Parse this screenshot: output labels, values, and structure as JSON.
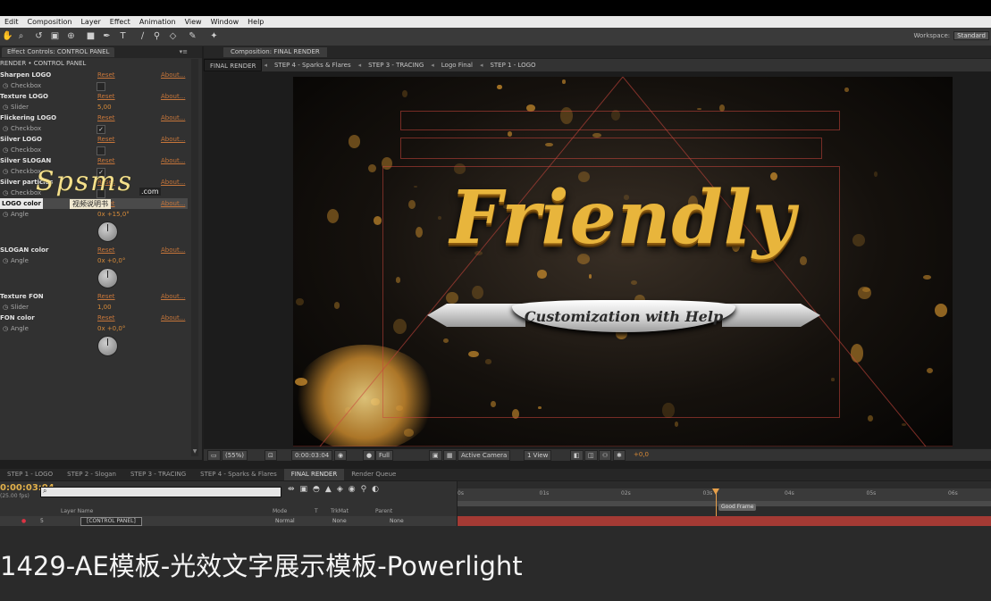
{
  "menu": [
    "Edit",
    "Composition",
    "Layer",
    "Effect",
    "Animation",
    "View",
    "Window",
    "Help"
  ],
  "workspace": {
    "label": "Workspace:",
    "value": "Standard"
  },
  "effect_controls": {
    "tab_label": "Effect Controls: CONTROL PANEL",
    "subtitle": "RENDER • CONTROL PANEL",
    "reset": "Reset",
    "about": "About...",
    "effects": [
      {
        "name": "Sharpen LOGO",
        "prop": "Checkbox",
        "kind": "checkbox",
        "checked": ""
      },
      {
        "name": "Texture LOGO",
        "prop": "Slider",
        "kind": "value",
        "value": "5,00"
      },
      {
        "name": "Flickering LOGO",
        "prop": "Checkbox",
        "kind": "checkbox",
        "checked": "✓"
      },
      {
        "name": "Silver LOGO",
        "prop": "Checkbox",
        "kind": "checkbox",
        "checked": ""
      },
      {
        "name": "Silver SLOGAN",
        "prop": "Checkbox",
        "kind": "checkbox",
        "checked": "✓"
      },
      {
        "name": "Silver particles",
        "prop": "Checkbox",
        "kind": "checkbox",
        "checked": ""
      },
      {
        "name": "LOGO color",
        "prop": "Angle",
        "kind": "angle",
        "value": "0x +15,0°"
      },
      {
        "name": "SLOGAN color",
        "prop": "Angle",
        "kind": "angle",
        "value": "0x +0,0°"
      },
      {
        "name": "Texture FON",
        "prop": "Slider",
        "kind": "value",
        "value": "1,00"
      },
      {
        "name": "FON color",
        "prop": "Angle",
        "kind": "angle",
        "value": "0x +0,0°"
      }
    ]
  },
  "watermark": {
    "brand": "Spsms",
    "domain": ".com",
    "subtitle": "视频说明书"
  },
  "composition": {
    "tab_label": "Composition: FINAL RENDER",
    "breadcrumbs": [
      "FINAL RENDER",
      "STEP 4 - Sparks & Flares",
      "STEP 3 - TRACING",
      "Logo Final",
      "STEP 1 - LOGO"
    ],
    "headline": "Friendly",
    "ribbon_text": "Customization with Help",
    "viewer": {
      "zoom": "(55%)",
      "timecode": "0:00:03:04",
      "resolution": "Full",
      "camera": "Active Camera",
      "views": "1 View",
      "exposure": "+0,0"
    }
  },
  "timeline": {
    "tabs": [
      "STEP 1 - LOGO",
      "STEP 2 - Slogan",
      "STEP 3 - TRACING",
      "STEP 4 - Sparks & Flares",
      "FINAL RENDER",
      "Render Queue"
    ],
    "active_tab": "FINAL RENDER",
    "timecode": "0:00:03:04",
    "fps": "(25.00 fps)",
    "columns": {
      "layer_name": "Layer Name",
      "mode": "Mode",
      "t": "T",
      "trkmat": "TrkMat",
      "parent": "Parent"
    },
    "layer": {
      "index": "5",
      "name": "[CONTROL PANEL]",
      "mode": "Normal",
      "trkmat": "None",
      "parent": "None"
    },
    "ruler": [
      "0s",
      "01s",
      "02s",
      "03s",
      "04s",
      "05s",
      "06s"
    ],
    "marker": "Good Frame"
  },
  "caption": "1429-AE模板-光效文字展示模板-Powerlight"
}
